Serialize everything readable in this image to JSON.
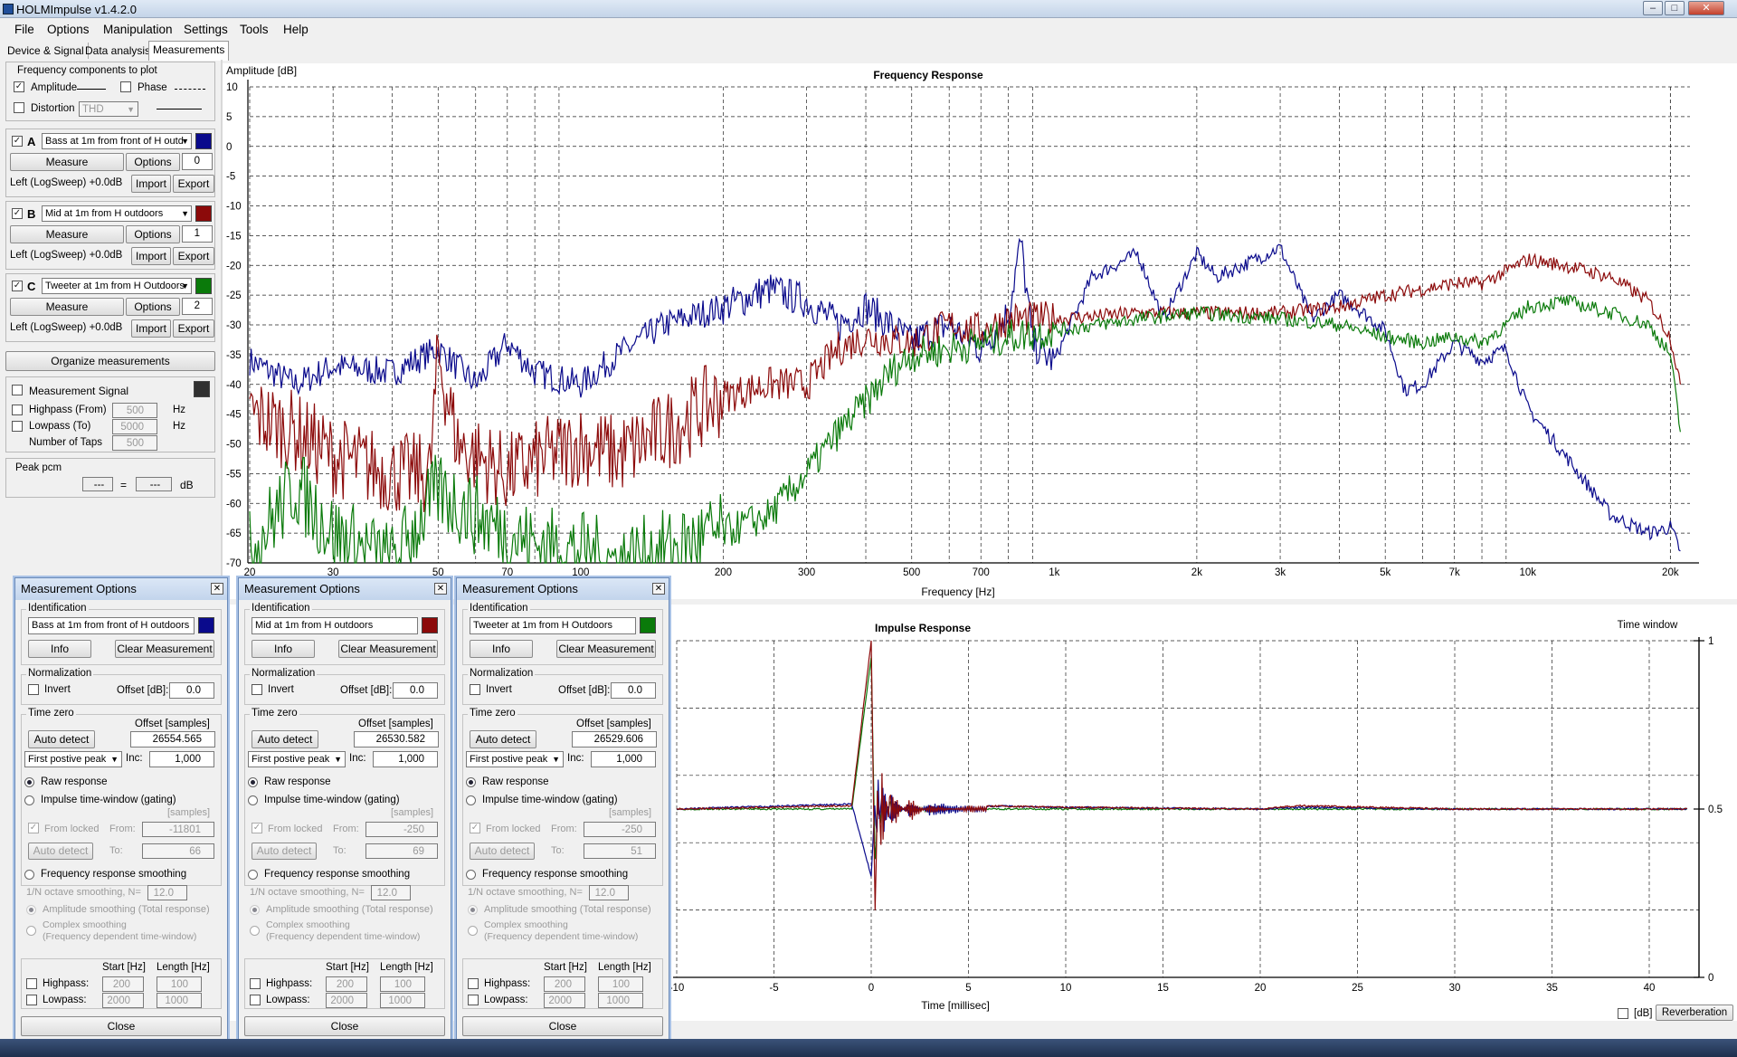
{
  "window": {
    "title": "HOLMImpulse  v1.4.2.0"
  },
  "menu": [
    "File",
    "Options",
    "Manipulation",
    "Settings",
    "Tools",
    "Help"
  ],
  "tabs": [
    "Device & Signal",
    "Data analysis",
    "Measurements"
  ],
  "freq_components": {
    "title": "Frequency components to plot",
    "amplitude": "Amplitude",
    "phase": "Phase",
    "distortion": "Distortion",
    "distortion_type": "THD"
  },
  "measurements": [
    {
      "letter": "A",
      "name": "Bass at 1m from front of H outd",
      "color": "#0a0a8c",
      "measure": "Measure",
      "options": "Options",
      "index": "0",
      "source": "Left (LogSweep) +0.0dB",
      "import": "Import",
      "export": "Export"
    },
    {
      "letter": "B",
      "name": "Mid at 1m from H outdoors",
      "color": "#8c0a0a",
      "measure": "Measure",
      "options": "Options",
      "index": "1",
      "source": "Left (LogSweep) +0.0dB",
      "import": "Import",
      "export": "Export"
    },
    {
      "letter": "C",
      "name": "Tweeter at 1m from H Outdoors",
      "color": "#0a7a0a",
      "measure": "Measure",
      "options": "Options",
      "index": "2",
      "source": "Left (LogSweep) +0.0dB",
      "import": "Import",
      "export": "Export"
    }
  ],
  "organize": "Organize measurements",
  "signal": {
    "label": "Measurement Signal",
    "highpass": "Highpass (From)",
    "highpass_val": "500",
    "lowpass": "Lowpass (To)",
    "lowpass_val": "5000",
    "taps": "Number of Taps",
    "taps_val": "500",
    "hz": "Hz"
  },
  "peak": {
    "label": "Peak pcm",
    "eq": "=",
    "unit": "dB",
    "v1": "---",
    "v2": "---"
  },
  "freq_chart": {
    "title": "Frequency Response",
    "ylabel": "Amplitude [dB]",
    "xlabel": "Frequency [Hz]",
    "yticks": [
      "10",
      "5",
      "0",
      "-5",
      "-10",
      "-15",
      "-20",
      "-25",
      "-30",
      "-35",
      "-40",
      "-45",
      "-50",
      "-55",
      "-60",
      "-65",
      "-70"
    ],
    "xticks": [
      "20",
      "30",
      "50",
      "70",
      "100",
      "200",
      "300",
      "500",
      "700",
      "1k",
      "2k",
      "3k",
      "5k",
      "7k",
      "10k",
      "20k"
    ]
  },
  "imp_chart": {
    "title": "Impulse Response",
    "xlabel": "Time [millisec]",
    "window_label": "Time window",
    "xticks": [
      "-10",
      "-5",
      "0",
      "5",
      "10",
      "15",
      "20",
      "25",
      "30",
      "35",
      "40"
    ],
    "rticks": [
      "1",
      "0.5",
      "0"
    ],
    "db": "[dB]",
    "reverb": "Reverberation"
  },
  "chart_data": [
    {
      "type": "line",
      "title": "Frequency Response",
      "xlabel": "Frequency [Hz]",
      "ylabel": "Amplitude [dB]",
      "xscale": "log",
      "xlim": [
        20,
        22000
      ],
      "ylim": [
        -70,
        10
      ],
      "series": [
        {
          "name": "Bass at 1m from front of H outdoors",
          "color": "#0a0a8c",
          "x": [
            20,
            25,
            30,
            40,
            50,
            60,
            70,
            80,
            100,
            120,
            150,
            200,
            250,
            300,
            350,
            400,
            450,
            500,
            550,
            600,
            700,
            800,
            850,
            900,
            950,
            1000,
            1200,
            1500,
            1700,
            2000,
            2200,
            2500,
            3000,
            3500,
            4000,
            4500,
            5000,
            5500,
            6000,
            7000,
            8000,
            9000,
            10000,
            12000,
            15000,
            18000,
            20000,
            21000
          ],
          "y": [
            -36,
            -40,
            -37,
            -38,
            -34,
            -40,
            -33,
            -38,
            -40,
            -35,
            -30,
            -27,
            -24,
            -26,
            -30,
            -27,
            -30,
            -33,
            -31,
            -30,
            -34,
            -28,
            -16,
            -33,
            -35,
            -36,
            -22,
            -18,
            -29,
            -18,
            -22,
            -20,
            -17,
            -29,
            -25,
            -28,
            -31,
            -41,
            -40,
            -33,
            -36,
            -34,
            -44,
            -52,
            -62,
            -65,
            -64,
            -68
          ]
        },
        {
          "name": "Mid at 1m from H outdoors",
          "color": "#8c0a0a",
          "x": [
            20,
            25,
            30,
            40,
            48,
            50,
            55,
            60,
            70,
            80,
            100,
            120,
            150,
            200,
            250,
            300,
            350,
            400,
            500,
            600,
            700,
            800,
            1000,
            1500,
            2000,
            3000,
            4000,
            5000,
            6000,
            7000,
            8000,
            9000,
            10000,
            12000,
            15000,
            18000,
            20000,
            21000
          ],
          "y": [
            -45,
            -48,
            -52,
            -55,
            -55,
            -35,
            -50,
            -52,
            -55,
            -53,
            -50,
            -52,
            -48,
            -42,
            -40,
            -40,
            -34,
            -32,
            -33,
            -30,
            -31,
            -29,
            -29,
            -28,
            -28,
            -28,
            -27,
            -25,
            -24,
            -23,
            -23,
            -21,
            -19,
            -20,
            -22,
            -26,
            -32,
            -40
          ]
        },
        {
          "name": "Tweeter at 1m from H Outdoors",
          "color": "#0a7a0a",
          "x": [
            20,
            25,
            30,
            40,
            50,
            60,
            70,
            80,
            100,
            120,
            150,
            200,
            250,
            300,
            350,
            400,
            450,
            500,
            600,
            700,
            800,
            1000,
            1500,
            2000,
            3000,
            4000,
            5000,
            6000,
            7000,
            8000,
            9000,
            10000,
            12000,
            15000,
            18000,
            20000,
            21000
          ],
          "y": [
            -68,
            -57,
            -65,
            -70,
            -58,
            -62,
            -65,
            -67,
            -68,
            -70,
            -68,
            -65,
            -62,
            -55,
            -48,
            -43,
            -38,
            -35,
            -34,
            -33,
            -32,
            -31,
            -29,
            -28,
            -29,
            -30,
            -32,
            -33,
            -32,
            -33,
            -30,
            -27,
            -26,
            -28,
            -30,
            -35,
            -48
          ]
        }
      ]
    },
    {
      "type": "line",
      "title": "Impulse Response",
      "xlabel": "Time [millisec]",
      "xlim": [
        -10,
        42
      ],
      "series": [
        {
          "name": "Bass at 1m from front of H outdoors",
          "color": "#0a0a8c",
          "x": [
            -10,
            -1,
            0,
            0.3,
            0.6,
            1,
            2,
            3,
            5,
            10,
            20,
            22,
            30,
            40,
            42
          ],
          "y": [
            0,
            0.03,
            -0.4,
            0.3,
            -0.2,
            0.1,
            -0.05,
            0.04,
            0.02,
            0.01,
            0,
            0.01,
            0,
            0,
            0
          ]
        },
        {
          "name": "Mid at 1m from H outdoors",
          "color": "#8c0a0a",
          "x": [
            -10,
            -1,
            0,
            0.2,
            0.5,
            1,
            2,
            3,
            5,
            10,
            20,
            22,
            30,
            40,
            42
          ],
          "y": [
            0,
            0.02,
            1,
            -0.6,
            0.3,
            -0.15,
            0.08,
            -0.03,
            0.02,
            0.01,
            0,
            0.02,
            0,
            0,
            0
          ]
        },
        {
          "name": "Tweeter at 1m from H Outdoors",
          "color": "#0a7a0a",
          "x": [
            -10,
            -1,
            0,
            0.2,
            0.5,
            1,
            2,
            5,
            10,
            20,
            42
          ],
          "y": [
            0,
            0,
            0.9,
            -0.3,
            0.1,
            -0.05,
            0.02,
            0,
            0,
            0,
            0
          ]
        }
      ]
    }
  ],
  "dialogs": [
    {
      "title": "Measurement Options",
      "identification": "Identification",
      "name": "Bass at 1m from front of H outdoors",
      "color": "#0a0a8c",
      "info": "Info",
      "clear": "Clear Measurement",
      "normalization": "Normalization",
      "invert": "Invert",
      "offset_db_label": "Offset [dB]:",
      "offset_db": "0.0",
      "time_zero": "Time zero",
      "offset_samples_label": "Offset [samples]",
      "auto_detect": "Auto detect",
      "offset_samples": "26554.565",
      "peak_mode": "First postive peak",
      "inc_label": "Inc:",
      "inc": "1,000",
      "raw": "Raw response",
      "gating": "Impulse time-window (gating)",
      "samples": "[samples]",
      "from_locked": "From locked",
      "from_label": "From:",
      "from": "-11801",
      "auto_detect2": "Auto detect",
      "to_label": "To:",
      "to": "66",
      "smoothing": "Frequency response smoothing",
      "octave": "1/N octave smoothing, N=",
      "octave_val": "12.0",
      "amp_smooth": "Amplitude smoothing (Total response)",
      "complex1": "Complex smoothing",
      "complex2": "(Frequency dependent time-window)",
      "start_hz": "Start [Hz]",
      "length_hz": "Length [Hz]",
      "highpass": "Highpass:",
      "hp_start": "200",
      "hp_len": "100",
      "lowpass": "Lowpass:",
      "lp_start": "2000",
      "lp_len": "1000",
      "close": "Close"
    },
    {
      "title": "Measurement Options",
      "identification": "Identification",
      "name": "Mid at 1m from H outdoors",
      "color": "#8c0a0a",
      "info": "Info",
      "clear": "Clear Measurement",
      "normalization": "Normalization",
      "invert": "Invert",
      "offset_db_label": "Offset [dB]:",
      "offset_db": "0.0",
      "time_zero": "Time zero",
      "offset_samples_label": "Offset [samples]",
      "auto_detect": "Auto detect",
      "offset_samples": "26530.582",
      "peak_mode": "First postive peak",
      "inc_label": "Inc:",
      "inc": "1,000",
      "raw": "Raw response",
      "gating": "Impulse time-window (gating)",
      "samples": "[samples]",
      "from_locked": "From locked",
      "from_label": "From:",
      "from": "-250",
      "auto_detect2": "Auto detect",
      "to_label": "To:",
      "to": "69",
      "smoothing": "Frequency response smoothing",
      "octave": "1/N octave smoothing, N=",
      "octave_val": "12.0",
      "amp_smooth": "Amplitude smoothing (Total response)",
      "complex1": "Complex smoothing",
      "complex2": "(Frequency dependent time-window)",
      "start_hz": "Start [Hz]",
      "length_hz": "Length [Hz]",
      "highpass": "Highpass:",
      "hp_start": "200",
      "hp_len": "100",
      "lowpass": "Lowpass:",
      "lp_start": "2000",
      "lp_len": "1000",
      "close": "Close"
    },
    {
      "title": "Measurement Options",
      "identification": "Identification",
      "name": "Tweeter at 1m from H Outdoors",
      "color": "#0a7a0a",
      "info": "Info",
      "clear": "Clear Measurement",
      "normalization": "Normalization",
      "invert": "Invert",
      "offset_db_label": "Offset [dB]:",
      "offset_db": "0.0",
      "time_zero": "Time zero",
      "offset_samples_label": "Offset [samples]",
      "auto_detect": "Auto detect",
      "offset_samples": "26529.606",
      "peak_mode": "First postive peak",
      "inc_label": "Inc:",
      "inc": "1,000",
      "raw": "Raw response",
      "gating": "Impulse time-window (gating)",
      "samples": "[samples]",
      "from_locked": "From locked",
      "from_label": "From:",
      "from": "-250",
      "auto_detect2": "Auto detect",
      "to_label": "To:",
      "to": "51",
      "smoothing": "Frequency response smoothing",
      "octave": "1/N octave smoothing, N=",
      "octave_val": "12.0",
      "amp_smooth": "Amplitude smoothing (Total response)",
      "complex1": "Complex smoothing",
      "complex2": "(Frequency dependent time-window)",
      "start_hz": "Start [Hz]",
      "length_hz": "Length [Hz]",
      "highpass": "Highpass:",
      "hp_start": "200",
      "hp_len": "100",
      "lowpass": "Lowpass:",
      "lp_start": "2000",
      "lp_len": "1000",
      "close": "Close"
    }
  ]
}
